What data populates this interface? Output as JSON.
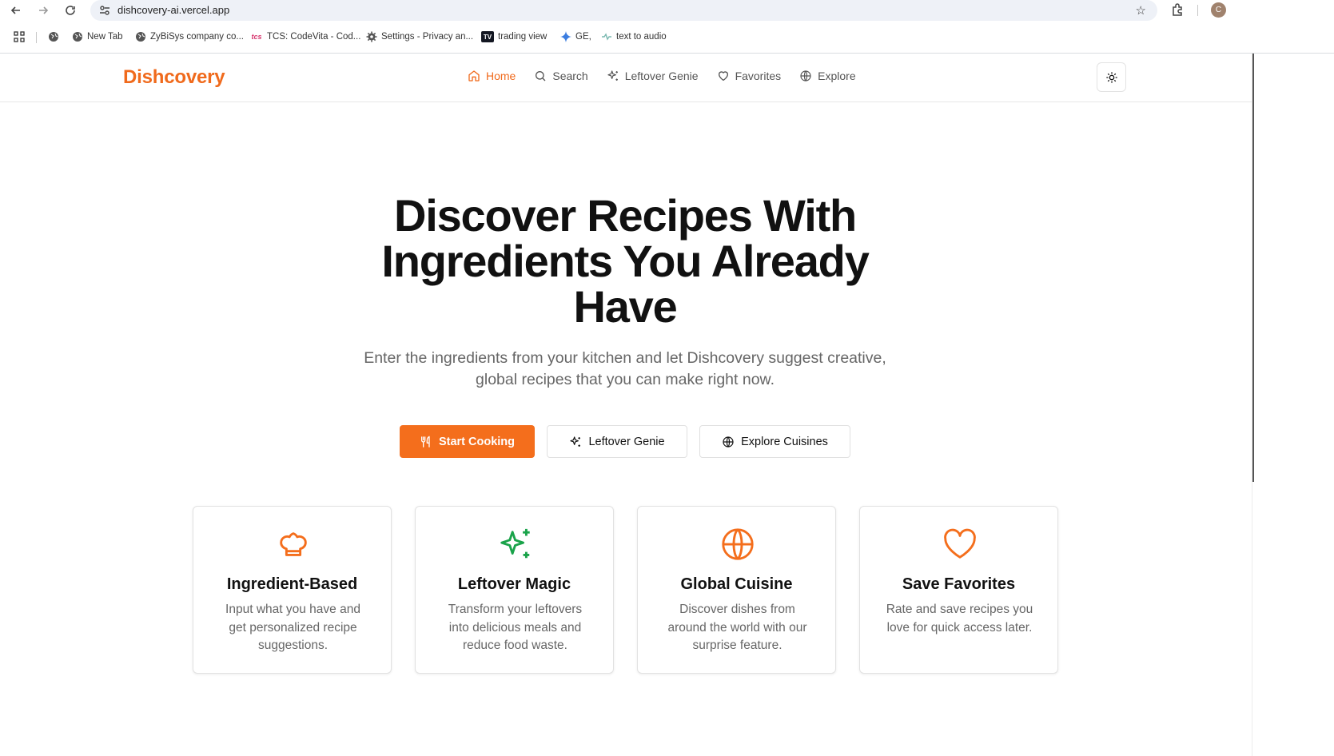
{
  "browser": {
    "url": "dishcovery-ai.vercel.app",
    "bookmarks": [
      {
        "label": "New Tab",
        "icon": "globe-icon"
      },
      {
        "label": "ZyBiSys company co...",
        "icon": "globe-icon"
      },
      {
        "label": "TCS: CodeVita - Cod...",
        "icon": "tcs-icon"
      },
      {
        "label": "Settings - Privacy an...",
        "icon": "gear-icon"
      },
      {
        "label": "trading view",
        "icon": "tradingview-icon"
      },
      {
        "label": "GE,",
        "icon": "gemini-icon"
      },
      {
        "label": "text to audio",
        "icon": "audio-icon"
      }
    ],
    "profile_initial": "C"
  },
  "header": {
    "logo": "Dishcovery",
    "nav": [
      {
        "label": "Home",
        "icon": "home-icon",
        "active": true
      },
      {
        "label": "Search",
        "icon": "search-icon"
      },
      {
        "label": "Leftover Genie",
        "icon": "sparkles-icon"
      },
      {
        "label": "Favorites",
        "icon": "heart-icon"
      },
      {
        "label": "Explore",
        "icon": "globe-icon"
      }
    ]
  },
  "hero": {
    "title_line1": "Discover Recipes With",
    "title_line2": "Ingredients You Already",
    "title_line3": "Have",
    "subtitle_line1": "Enter the ingredients from your kitchen and let Dishcovery suggest creative,",
    "subtitle_line2": "global recipes that you can make right now.",
    "buttons": {
      "start": "Start Cooking",
      "genie": "Leftover Genie",
      "explore": "Explore Cuisines"
    }
  },
  "features": [
    {
      "title": "Ingredient-Based",
      "desc": "Input what you have and get personalized recipe suggestions.",
      "icon": "chef-hat-icon"
    },
    {
      "title": "Leftover Magic",
      "desc": "Transform your leftovers into delicious meals and reduce food waste.",
      "icon": "sparkles-icon"
    },
    {
      "title": "Global Cuisine",
      "desc": "Discover dishes from around the world with our surprise feature.",
      "icon": "globe-icon"
    },
    {
      "title": "Save Favorites",
      "desc": "Rate and save recipes you love for quick access later.",
      "icon": "heart-icon"
    }
  ],
  "colors": {
    "accent": "#f46e1c",
    "magic_green": "#1aa34a"
  }
}
